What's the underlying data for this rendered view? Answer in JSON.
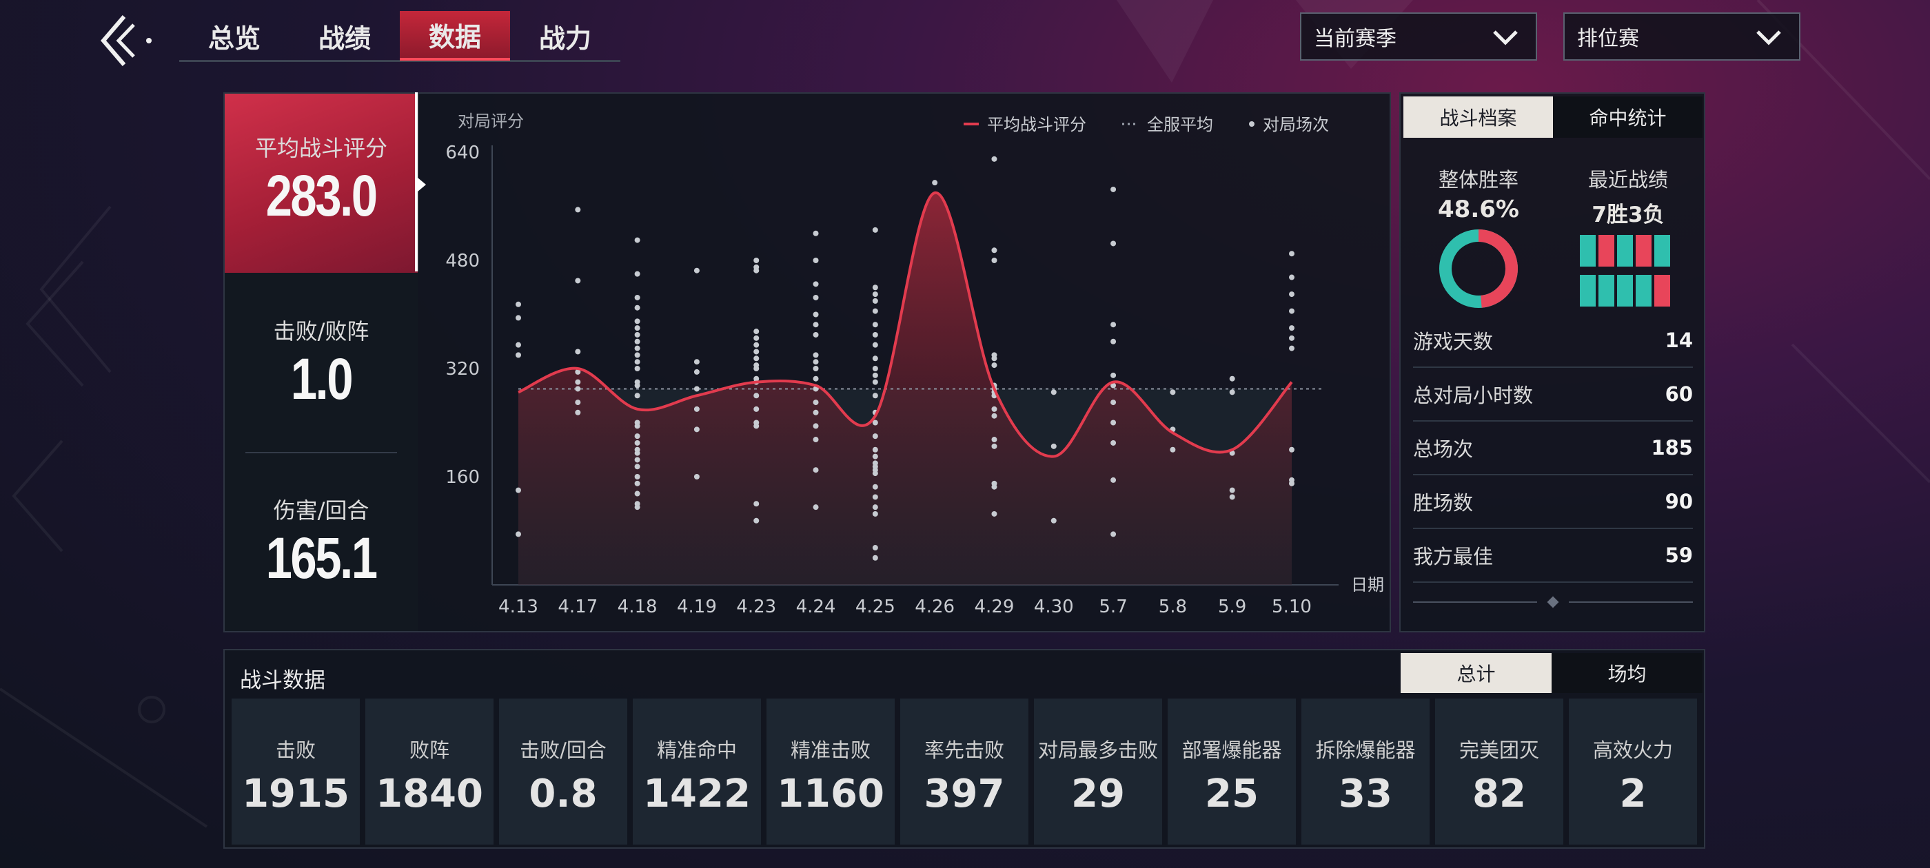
{
  "nav": {
    "tabs": [
      {
        "label": "总览",
        "active": false
      },
      {
        "label": "战绩",
        "active": false
      },
      {
        "label": "数据",
        "active": true
      },
      {
        "label": "战力",
        "active": false
      }
    ],
    "season_select": "当前赛季",
    "mode_select": "排位赛"
  },
  "summary": {
    "avg_score_label": "平均战斗评分",
    "avg_score_value": "283.0",
    "kd_label": "击败/败阵",
    "kd_value": "1.0",
    "dmg_label": "伤害/回合",
    "dmg_value": "165.1"
  },
  "chart_data": {
    "type": "line",
    "ylabel": "对局评分",
    "xlabel": "日期",
    "ylim": [
      0,
      640
    ],
    "yticks": [
      "640",
      "480",
      "320",
      "160"
    ],
    "categories": [
      "4.13",
      "4.17",
      "4.18",
      "4.19",
      "4.23",
      "4.24",
      "4.25",
      "4.26",
      "4.29",
      "4.30",
      "5.7",
      "5.8",
      "5.9",
      "5.10"
    ],
    "legend": [
      "平均战斗评分",
      "全服平均",
      "对局场次"
    ],
    "average_line": 290,
    "series": [
      {
        "name": "平均战斗评分",
        "values": [
          285,
          320,
          260,
          280,
          300,
          295,
          250,
          580,
          290,
          190,
          300,
          225,
          200,
          300
        ]
      }
    ],
    "points": [
      [
        415,
        395,
        355,
        340,
        140,
        75
      ],
      [
        555,
        450,
        345,
        315,
        300,
        290,
        270,
        255
      ],
      [
        510,
        460,
        425,
        410,
        390,
        380,
        370,
        360,
        350,
        340,
        330,
        320,
        300,
        295,
        280,
        240,
        235,
        220,
        210,
        200,
        195,
        185,
        175,
        160,
        150,
        135,
        120,
        115
      ],
      [
        465,
        330,
        315,
        290,
        260,
        230,
        160
      ],
      [
        480,
        470,
        465,
        375,
        365,
        355,
        345,
        335,
        325,
        320,
        305,
        300,
        280,
        260,
        240,
        235,
        120,
        95
      ],
      [
        520,
        480,
        445,
        425,
        400,
        385,
        370,
        340,
        330,
        320,
        305,
        290,
        270,
        255,
        235,
        215,
        170,
        115
      ],
      [
        525,
        440,
        430,
        420,
        405,
        385,
        370,
        355,
        335,
        320,
        310,
        300,
        280,
        255,
        240,
        220,
        200,
        190,
        180,
        175,
        170,
        165,
        145,
        130,
        115,
        105,
        55,
        40
      ],
      [
        595
      ],
      [
        630,
        495,
        480,
        340,
        335,
        325,
        295,
        290,
        285,
        280,
        260,
        250,
        215,
        205,
        150,
        145,
        105
      ],
      [
        285,
        205,
        95
      ],
      [
        585,
        505,
        385,
        360,
        310,
        295,
        270,
        240,
        210,
        155,
        75
      ],
      [
        285,
        230,
        200
      ],
      [
        305,
        285,
        195,
        140,
        130
      ],
      [
        490,
        455,
        430,
        405,
        380,
        365,
        350,
        200,
        155,
        150
      ]
    ]
  },
  "side": {
    "tab_profile": "战斗档案",
    "tab_hit": "命中统计",
    "winrate_label": "整体胜率",
    "winrate_value": "48.6%",
    "winrate": 0.486,
    "recent_label": "最近战绩",
    "recent_value": "7胜3负",
    "recent_results": [
      "W",
      "L",
      "W",
      "L",
      "W",
      "W",
      "W",
      "W",
      "W",
      "L"
    ],
    "rows": [
      {
        "label": "游戏天数",
        "value": "14"
      },
      {
        "label": "总对局小时数",
        "value": "60"
      },
      {
        "label": "总场次",
        "value": "185"
      },
      {
        "label": "胜场数",
        "value": "90"
      },
      {
        "label": "我方最佳",
        "value": "59"
      }
    ]
  },
  "battle": {
    "title": "战斗数据",
    "tab_total": "总计",
    "tab_per_match": "场均",
    "stats": [
      {
        "label": "击败",
        "value": "1915"
      },
      {
        "label": "败阵",
        "value": "1840"
      },
      {
        "label": "击败/回合",
        "value": "0.8"
      },
      {
        "label": "精准命中",
        "value": "1422"
      },
      {
        "label": "精准击败",
        "value": "1160"
      },
      {
        "label": "率先击败",
        "value": "397"
      },
      {
        "label": "对局最多击败",
        "value": "29"
      },
      {
        "label": "部署爆能器",
        "value": "25"
      },
      {
        "label": "拆除爆能器",
        "value": "33"
      },
      {
        "label": "完美团灭",
        "value": "82"
      },
      {
        "label": "高效火力",
        "value": "2"
      }
    ]
  },
  "colors": {
    "accent": "#e23b4e",
    "win": "#2fbfae",
    "loss": "#e8455a",
    "dots": "#c7cbd1"
  }
}
